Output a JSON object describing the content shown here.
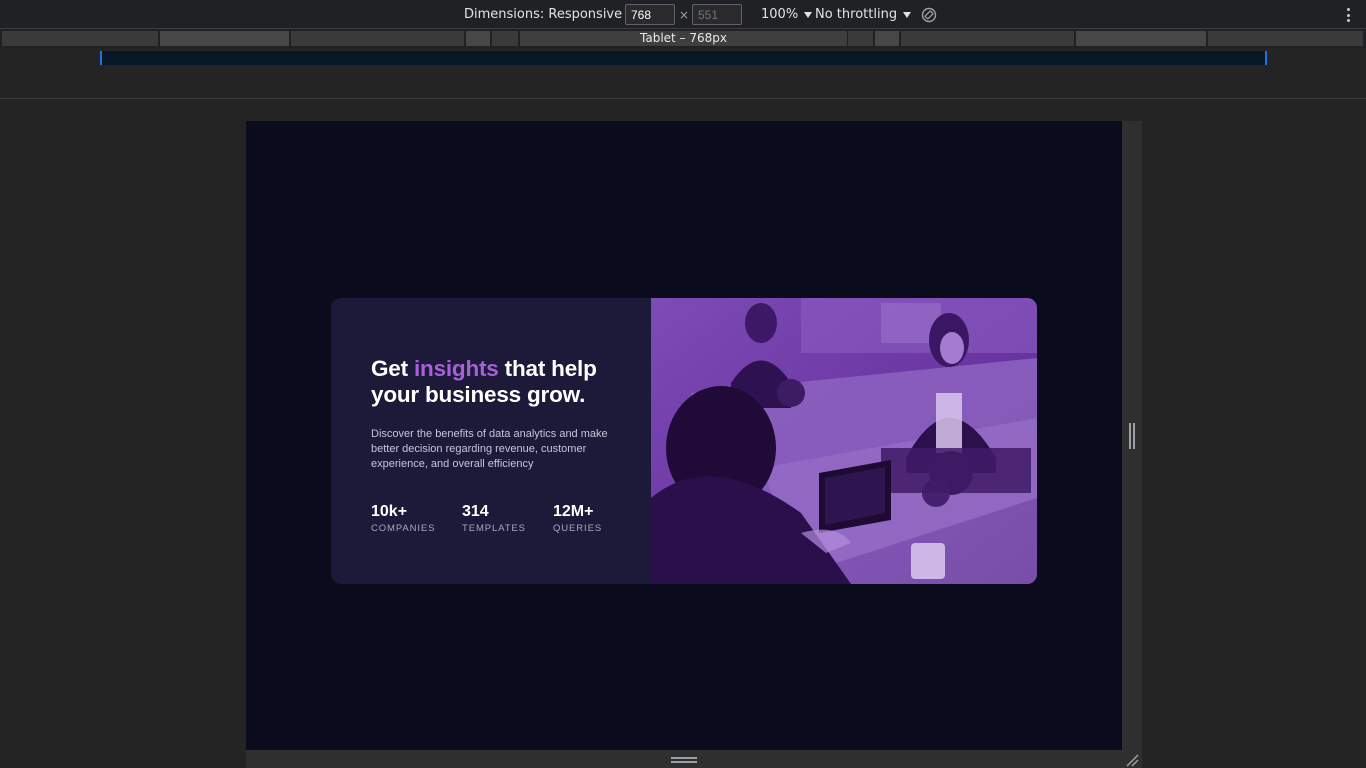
{
  "devtools": {
    "dimensions_label": "Dimensions: Responsive",
    "width_value": "768",
    "height_placeholder": "551",
    "times_sign": "×",
    "zoom": "100%",
    "throttling": "No throttling",
    "media_query_label": "Tablet – 768px",
    "icons": {
      "dimensions_caret": "chevron-down-icon",
      "zoom_caret": "chevron-down-icon",
      "throttling_caret": "chevron-down-icon",
      "rotate": "rotate-icon",
      "more": "more-vertical-icon",
      "resize_corner": "resize-corner-icon"
    }
  },
  "card": {
    "headline_part1": "Get ",
    "headline_accent": "insights",
    "headline_part2": " that help your business grow.",
    "description": "Discover the benefits of data analytics and make better decision regarding revenue, customer experience, and overall efficiency",
    "stats": [
      {
        "value": "10k+",
        "label": "COMPANIES"
      },
      {
        "value": "314",
        "label": "TEMPLATES"
      },
      {
        "value": "12M+",
        "label": "QUERIES"
      }
    ]
  },
  "colors": {
    "page_background": "#0a0c1d",
    "card_background": "#1c1a38",
    "accent": "#a660d9",
    "photo_overlay": "#6a2fa6",
    "devtools_background": "#202124"
  }
}
